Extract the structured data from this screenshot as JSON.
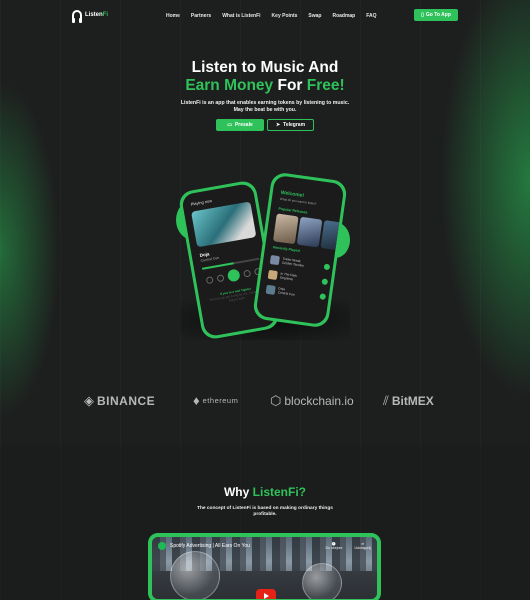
{
  "nav": {
    "logo_prefix": "Listen",
    "logo_suffix": "Fi",
    "items": [
      "Home",
      "Partners",
      "What is ListenFi",
      "Key Points",
      "Swap",
      "Roadmap",
      "FAQ"
    ],
    "cta": "Go To App"
  },
  "hero": {
    "line1": "Listen to Music And",
    "line2_a": "Earn Money",
    "line2_b": "For",
    "line2_c": "Free!",
    "subtitle": "ListenFi is an app that enables earning tokens by listening to music. May the beat be with you.",
    "btn_presale": "Presale",
    "btn_telegram": "Telegram"
  },
  "phone_back": {
    "header": "Playing now",
    "song": "Doja",
    "artist": "Central Cee",
    "lyric_line": "If you're a real Tighter",
    "lyric_rest": "Told me you got a ring for me, I know that they're both"
  },
  "phone_front": {
    "greeting": "Welcome!",
    "subline": "What do you want to listen?",
    "section1": "Popular Releases",
    "section2": "Recently Played",
    "tracks": [
      {
        "title": "Trailer Break",
        "artist": "Golden Tacoleo"
      },
      {
        "title": "In The Dark",
        "artist": "Drippless"
      },
      {
        "title": "Doja",
        "artist": "Central Cee"
      }
    ]
  },
  "partners": {
    "binance": "BINANCE",
    "ethereum": "ethereum",
    "blockchain": "blockchain.io",
    "bitmex": "BitMEX"
  },
  "why": {
    "title_a": "Why",
    "title_b": "ListenFi?",
    "subtitle": "The concept of ListenFi is based on making ordinary things profitable.",
    "video_title": "Spotify Advertising | All Ears On You",
    "watch_later": "Do obejrze",
    "share": "Udostępnij"
  },
  "colors": {
    "accent": "#2fc25b",
    "background": "#1d1e1e"
  }
}
